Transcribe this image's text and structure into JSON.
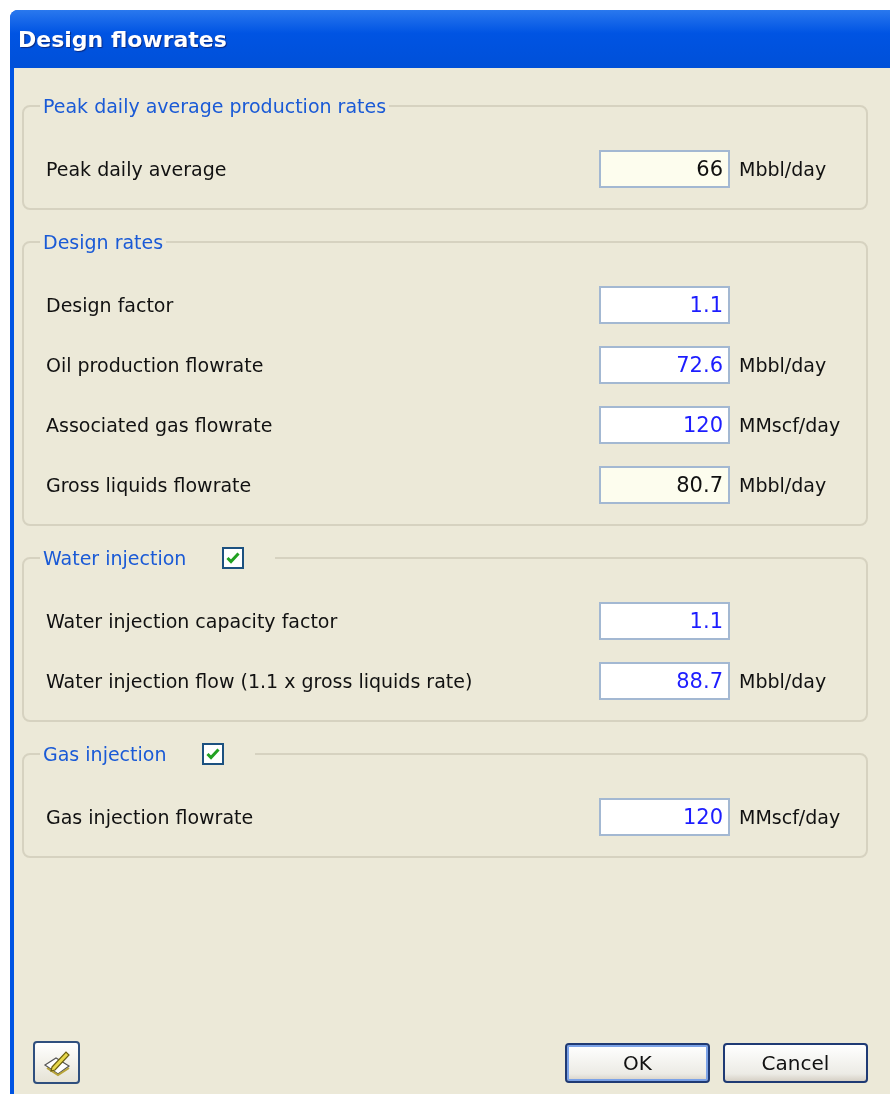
{
  "window": {
    "title": "Design flowrates"
  },
  "groups": [
    {
      "title": "Peak daily average production rates",
      "rows": [
        {
          "label": "Peak daily average",
          "value": "66",
          "unit": "Mbbl/day",
          "readonly": true
        }
      ]
    },
    {
      "title": "Design rates",
      "rows": [
        {
          "label": "Design factor",
          "value": "1.1",
          "readonly": false
        },
        {
          "label": "Oil production flowrate",
          "value": "72.6",
          "unit": "Mbbl/day",
          "readonly": false
        },
        {
          "label": "Associated gas flowrate",
          "value": "120",
          "unit": "MMscf/day",
          "readonly": false
        },
        {
          "label": "Gross liquids flowrate",
          "value": "80.7",
          "unit": "Mbbl/day",
          "readonly": true
        }
      ]
    },
    {
      "title": "Water injection",
      "checked": true,
      "rows": [
        {
          "label": "Water injection capacity factor",
          "value": "1.1",
          "readonly": false
        },
        {
          "label": "Water injection flow (1.1 x gross liquids rate)",
          "value": "88.7",
          "unit": "Mbbl/day",
          "readonly": false
        }
      ]
    },
    {
      "title": "Gas injection",
      "checked": true,
      "rows": [
        {
          "label": "Gas injection flowrate",
          "value": "120",
          "unit": "MMscf/day",
          "readonly": false
        }
      ]
    }
  ],
  "buttons": [
    "OK",
    "Cancel"
  ]
}
